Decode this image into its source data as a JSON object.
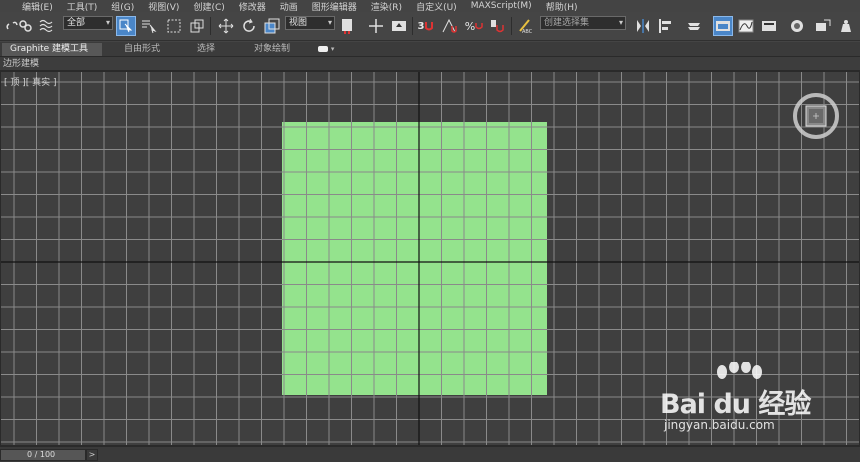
{
  "menu": [
    "编辑(E)",
    "工具(T)",
    "组(G)",
    "视图(V)",
    "创建(C)",
    "修改器",
    "动画",
    "图形编辑器",
    "渲染(R)",
    "自定义(U)",
    "MAXScript(M)",
    "帮助(H)"
  ],
  "toolbar": {
    "selection_filter": "全部",
    "reference_coord": "视图",
    "named_selection_placeholder": "创建选择集",
    "snap_label": "3"
  },
  "ribbon": {
    "tabs": [
      "Graphite 建模工具",
      "自由形式",
      "选择",
      "对象绘制"
    ]
  },
  "subbar": {
    "label": "边形建模"
  },
  "viewport": {
    "label": "[ 顶 ][ 真实 ]",
    "plane_color": "#94e38d",
    "grid_color": "#8a8a8a",
    "axis_color": "#111111",
    "background": "#3f3f3f"
  },
  "status": {
    "frame": "0 / 100",
    "next": ">"
  },
  "watermark": {
    "brand": "Bai du 经验",
    "url": "jingyan.baidu.com"
  }
}
